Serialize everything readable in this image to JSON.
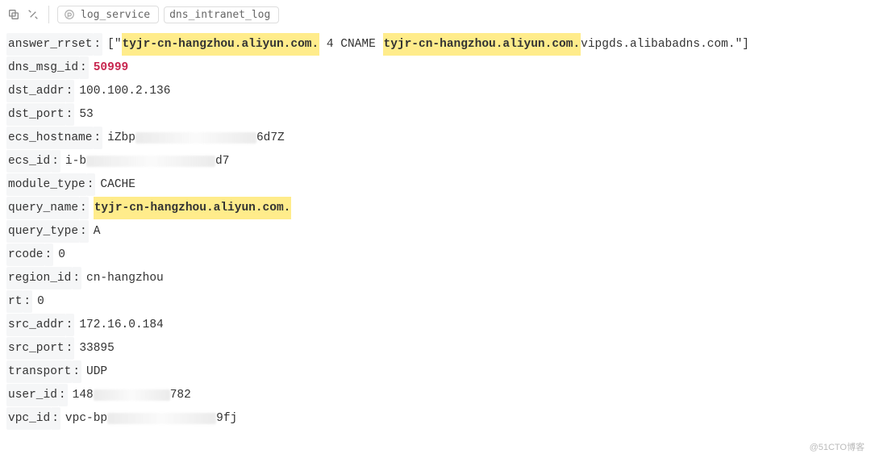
{
  "toolbar": {
    "pill1": "log_service",
    "pill2": "dns_intranet_log"
  },
  "log": {
    "answer_rrset": {
      "key": "answer_rrset",
      "open": "[\"",
      "hl1": "tyjr-cn-hangzhou.aliyun.com.",
      "mid": " 4 CNAME ",
      "hl2": "tyjr-cn-hangzhou.aliyun.com.",
      "tail": "vipgds.alibabadns.com.",
      "close": "\"]"
    },
    "dns_msg_id": {
      "key": "dns_msg_id",
      "value": "50999"
    },
    "dst_addr": {
      "key": "dst_addr",
      "value": "100.100.2.136"
    },
    "dst_port": {
      "key": "dst_port",
      "value": "53"
    },
    "ecs_hostname": {
      "key": "ecs_hostname",
      "prefix": "iZbp",
      "suffix": "6d7Z"
    },
    "ecs_id": {
      "key": "ecs_id",
      "prefix": "i-b",
      "suffix": "d7"
    },
    "module_type": {
      "key": "module_type",
      "value": "CACHE"
    },
    "query_name": {
      "key": "query_name",
      "value": "tyjr-cn-hangzhou.aliyun.com."
    },
    "query_type": {
      "key": "query_type",
      "value": "A"
    },
    "rcode": {
      "key": "rcode",
      "value": "0"
    },
    "region_id": {
      "key": "region_id",
      "value": "cn-hangzhou"
    },
    "rt": {
      "key": "rt",
      "value": "0"
    },
    "src_addr": {
      "key": "src_addr",
      "value": "172.16.0.184"
    },
    "src_port": {
      "key": "src_port",
      "value": "33895"
    },
    "transport": {
      "key": "transport",
      "value": "UDP"
    },
    "user_id": {
      "key": "user_id",
      "prefix": "148",
      "suffix": "782"
    },
    "vpc_id": {
      "key": "vpc_id",
      "prefix": "vpc-bp",
      "suffix": "9fj"
    }
  },
  "watermark": "@51CTO博客"
}
